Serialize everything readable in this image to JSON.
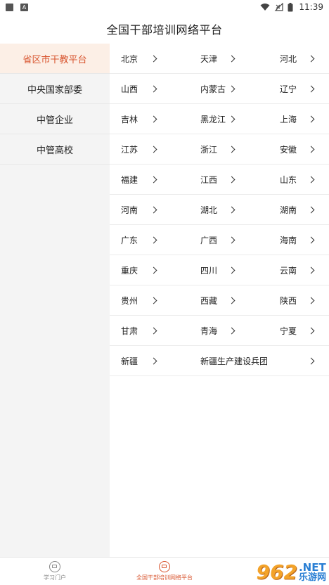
{
  "status_bar": {
    "time": "11:39",
    "icons": [
      "notification-square-icon",
      "a-badge-icon",
      "wifi-icon",
      "signal-off-icon",
      "battery-icon"
    ]
  },
  "header": {
    "title": "全国干部培训网络平台"
  },
  "left_menu": {
    "active_index": 0,
    "items": [
      {
        "label": "省区市干教平台"
      },
      {
        "label": "中央国家部委"
      },
      {
        "label": "中管企业"
      },
      {
        "label": "中管高校"
      }
    ]
  },
  "regions": {
    "rows": [
      [
        "北京",
        "天津",
        "河北"
      ],
      [
        "山西",
        "内蒙古",
        "辽宁"
      ],
      [
        "吉林",
        "黑龙江",
        "上海"
      ],
      [
        "江苏",
        "浙江",
        "安徽"
      ],
      [
        "福建",
        "江西",
        "山东"
      ],
      [
        "河南",
        "湖北",
        "湖南"
      ],
      [
        "广东",
        "广西",
        "海南"
      ],
      [
        "重庆",
        "四川",
        "云南"
      ],
      [
        "贵州",
        "西藏",
        "陕西"
      ],
      [
        "甘肃",
        "青海",
        "宁夏"
      ],
      [
        "新疆",
        "新疆生产建设兵团"
      ]
    ]
  },
  "bottom_nav": {
    "active_index": 1,
    "items": [
      {
        "label": "学习门户",
        "icon": "portal-icon"
      },
      {
        "label": "全国干部培训网络平台",
        "icon": "platform-icon"
      }
    ]
  },
  "watermark": {
    "number": "962",
    "suffix": ".NET",
    "text": "乐游网"
  },
  "colors": {
    "accent": "#d8542e",
    "active_bg": "#fcefe6",
    "menu_bg": "#f4f4f4"
  }
}
